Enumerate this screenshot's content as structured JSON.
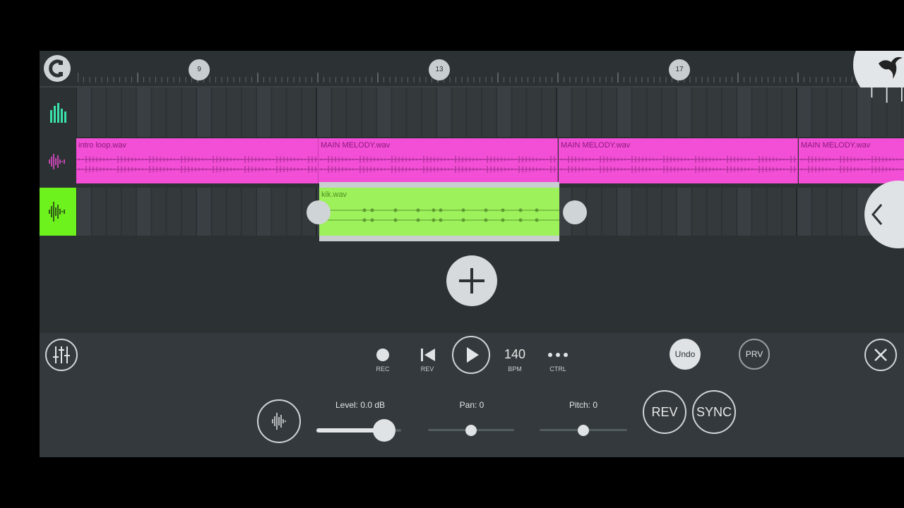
{
  "ruler": {
    "markers": [
      "9",
      "13",
      "17"
    ]
  },
  "tracks": {
    "pink_clips": [
      "intro loop.wav",
      "MAIN MELODY.wav",
      "MAIN MELODY.wav",
      "MAIN MELODY.wav"
    ],
    "green_clip": "kik.wav"
  },
  "transport": {
    "rec_label": "REC",
    "rev_label": "REV",
    "bpm_value": "140",
    "bpm_label": "BPM",
    "ctrl_label": "CTRL",
    "undo_label": "Undo",
    "prv_label": "PRV"
  },
  "channel": {
    "level_label": "Level: 0.0 dB",
    "pan_label": "Pan: 0",
    "pitch_label": "Pitch: 0",
    "level_fraction": 0.8,
    "pan_fraction": 0.5,
    "pitch_fraction": 0.5,
    "rev_button": "REV",
    "sync_button": "SYNC"
  },
  "colors": {
    "accent_green": "#9df15a",
    "clip_pink": "#f34ed6",
    "background": "#2c3134"
  }
}
